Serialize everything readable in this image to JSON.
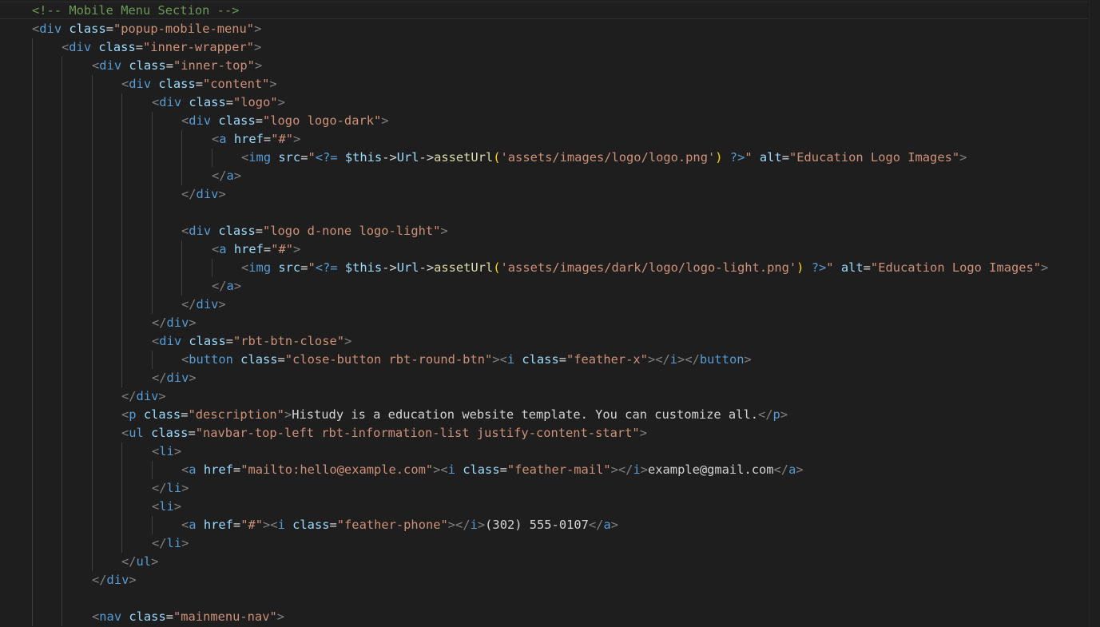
{
  "editor": {
    "theme": {
      "background": "#1e1e1e",
      "comment": "#6a9955",
      "tag": "#569cd6",
      "attribute": "#9cdcfe",
      "string": "#ce9178",
      "text": "#d4d4d4",
      "punctuation": "#808080",
      "function": "#dcdcaa",
      "bracket": "#ffd700"
    },
    "lines": [
      {
        "indent": 1,
        "tokens": [
          [
            "<!-- Mobile Menu Section -->",
            "comment"
          ]
        ]
      },
      {
        "indent": 1,
        "tokens": [
          [
            "<",
            "punct"
          ],
          [
            "div",
            "tag"
          ],
          [
            " ",
            "text"
          ],
          [
            "class",
            "attr"
          ],
          [
            "=",
            "eq"
          ],
          [
            "\"popup-mobile-menu\"",
            "str"
          ],
          [
            ">",
            "punct"
          ]
        ]
      },
      {
        "indent": 2,
        "tokens": [
          [
            "<",
            "punct"
          ],
          [
            "div",
            "tag"
          ],
          [
            " ",
            "text"
          ],
          [
            "class",
            "attr"
          ],
          [
            "=",
            "eq"
          ],
          [
            "\"inner-wrapper\"",
            "str"
          ],
          [
            ">",
            "punct"
          ]
        ]
      },
      {
        "indent": 3,
        "tokens": [
          [
            "<",
            "punct"
          ],
          [
            "div",
            "tag"
          ],
          [
            " ",
            "text"
          ],
          [
            "class",
            "attr"
          ],
          [
            "=",
            "eq"
          ],
          [
            "\"inner-top\"",
            "str"
          ],
          [
            ">",
            "punct"
          ]
        ]
      },
      {
        "indent": 4,
        "tokens": [
          [
            "<",
            "punct"
          ],
          [
            "div",
            "tag"
          ],
          [
            " ",
            "text"
          ],
          [
            "class",
            "attr"
          ],
          [
            "=",
            "eq"
          ],
          [
            "\"content\"",
            "str"
          ],
          [
            ">",
            "punct"
          ]
        ]
      },
      {
        "indent": 5,
        "tokens": [
          [
            "<",
            "punct"
          ],
          [
            "div",
            "tag"
          ],
          [
            " ",
            "text"
          ],
          [
            "class",
            "attr"
          ],
          [
            "=",
            "eq"
          ],
          [
            "\"logo\"",
            "str"
          ],
          [
            ">",
            "punct"
          ]
        ]
      },
      {
        "indent": 6,
        "tokens": [
          [
            "<",
            "punct"
          ],
          [
            "div",
            "tag"
          ],
          [
            " ",
            "text"
          ],
          [
            "class",
            "attr"
          ],
          [
            "=",
            "eq"
          ],
          [
            "\"logo logo-dark\"",
            "str"
          ],
          [
            ">",
            "punct"
          ]
        ]
      },
      {
        "indent": 7,
        "tokens": [
          [
            "<",
            "punct"
          ],
          [
            "a",
            "tag"
          ],
          [
            " ",
            "text"
          ],
          [
            "href",
            "attr"
          ],
          [
            "=",
            "eq"
          ],
          [
            "\"#\"",
            "str"
          ],
          [
            ">",
            "punct"
          ]
        ]
      },
      {
        "indent": 8,
        "tokens": [
          [
            "<",
            "punct"
          ],
          [
            "img",
            "tag"
          ],
          [
            " ",
            "text"
          ],
          [
            "src",
            "attr"
          ],
          [
            "=",
            "eq"
          ],
          [
            "\"",
            "str"
          ],
          [
            "<?=",
            "php"
          ],
          [
            " ",
            "text"
          ],
          [
            "$this",
            "var"
          ],
          [
            "->",
            "op"
          ],
          [
            "Url",
            "var"
          ],
          [
            "->",
            "op"
          ],
          [
            "assetUrl",
            "fn"
          ],
          [
            "(",
            "paren"
          ],
          [
            "'assets/images/logo/logo.png'",
            "str"
          ],
          [
            ")",
            "paren"
          ],
          [
            " ",
            "text"
          ],
          [
            "?>",
            "php"
          ],
          [
            "\"",
            "str"
          ],
          [
            " ",
            "text"
          ],
          [
            "alt",
            "attr"
          ],
          [
            "=",
            "eq"
          ],
          [
            "\"Education Logo Images\"",
            "str"
          ],
          [
            ">",
            "punct"
          ]
        ]
      },
      {
        "indent": 7,
        "tokens": [
          [
            "</",
            "punct"
          ],
          [
            "a",
            "tag"
          ],
          [
            ">",
            "punct"
          ]
        ]
      },
      {
        "indent": 6,
        "tokens": [
          [
            "</",
            "punct"
          ],
          [
            "div",
            "tag"
          ],
          [
            ">",
            "punct"
          ]
        ]
      },
      {
        "indent": 6,
        "tokens": []
      },
      {
        "indent": 6,
        "tokens": [
          [
            "<",
            "punct"
          ],
          [
            "div",
            "tag"
          ],
          [
            " ",
            "text"
          ],
          [
            "class",
            "attr"
          ],
          [
            "=",
            "eq"
          ],
          [
            "\"logo d-none logo-light\"",
            "str"
          ],
          [
            ">",
            "punct"
          ]
        ]
      },
      {
        "indent": 7,
        "tokens": [
          [
            "<",
            "punct"
          ],
          [
            "a",
            "tag"
          ],
          [
            " ",
            "text"
          ],
          [
            "href",
            "attr"
          ],
          [
            "=",
            "eq"
          ],
          [
            "\"#\"",
            "str"
          ],
          [
            ">",
            "punct"
          ]
        ]
      },
      {
        "indent": 8,
        "tokens": [
          [
            "<",
            "punct"
          ],
          [
            "img",
            "tag"
          ],
          [
            " ",
            "text"
          ],
          [
            "src",
            "attr"
          ],
          [
            "=",
            "eq"
          ],
          [
            "\"",
            "str"
          ],
          [
            "<?=",
            "php"
          ],
          [
            " ",
            "text"
          ],
          [
            "$this",
            "var"
          ],
          [
            "->",
            "op"
          ],
          [
            "Url",
            "var"
          ],
          [
            "->",
            "op"
          ],
          [
            "assetUrl",
            "fn"
          ],
          [
            "(",
            "paren"
          ],
          [
            "'assets/images/dark/logo/logo-light.png'",
            "str"
          ],
          [
            ")",
            "paren"
          ],
          [
            " ",
            "text"
          ],
          [
            "?>",
            "php"
          ],
          [
            "\"",
            "str"
          ],
          [
            " ",
            "text"
          ],
          [
            "alt",
            "attr"
          ],
          [
            "=",
            "eq"
          ],
          [
            "\"Education Logo Images\"",
            "str"
          ],
          [
            ">",
            "punct"
          ]
        ]
      },
      {
        "indent": 7,
        "tokens": [
          [
            "</",
            "punct"
          ],
          [
            "a",
            "tag"
          ],
          [
            ">",
            "punct"
          ]
        ]
      },
      {
        "indent": 6,
        "tokens": [
          [
            "</",
            "punct"
          ],
          [
            "div",
            "tag"
          ],
          [
            ">",
            "punct"
          ]
        ]
      },
      {
        "indent": 5,
        "tokens": [
          [
            "</",
            "punct"
          ],
          [
            "div",
            "tag"
          ],
          [
            ">",
            "punct"
          ]
        ]
      },
      {
        "indent": 5,
        "tokens": [
          [
            "<",
            "punct"
          ],
          [
            "div",
            "tag"
          ],
          [
            " ",
            "text"
          ],
          [
            "class",
            "attr"
          ],
          [
            "=",
            "eq"
          ],
          [
            "\"rbt-btn-close\"",
            "str"
          ],
          [
            ">",
            "punct"
          ]
        ]
      },
      {
        "indent": 6,
        "tokens": [
          [
            "<",
            "punct"
          ],
          [
            "button",
            "tag"
          ],
          [
            " ",
            "text"
          ],
          [
            "class",
            "attr"
          ],
          [
            "=",
            "eq"
          ],
          [
            "\"close-button rbt-round-btn\"",
            "str"
          ],
          [
            ">",
            "punct"
          ],
          [
            "<",
            "punct"
          ],
          [
            "i",
            "tag"
          ],
          [
            " ",
            "text"
          ],
          [
            "class",
            "attr"
          ],
          [
            "=",
            "eq"
          ],
          [
            "\"feather-x\"",
            "str"
          ],
          [
            ">",
            "punct"
          ],
          [
            "</",
            "punct"
          ],
          [
            "i",
            "tag"
          ],
          [
            ">",
            "punct"
          ],
          [
            "</",
            "punct"
          ],
          [
            "button",
            "tag"
          ],
          [
            ">",
            "punct"
          ]
        ]
      },
      {
        "indent": 5,
        "tokens": [
          [
            "</",
            "punct"
          ],
          [
            "div",
            "tag"
          ],
          [
            ">",
            "punct"
          ]
        ]
      },
      {
        "indent": 4,
        "tokens": [
          [
            "</",
            "punct"
          ],
          [
            "div",
            "tag"
          ],
          [
            ">",
            "punct"
          ]
        ]
      },
      {
        "indent": 4,
        "tokens": [
          [
            "<",
            "punct"
          ],
          [
            "p",
            "tag"
          ],
          [
            " ",
            "text"
          ],
          [
            "class",
            "attr"
          ],
          [
            "=",
            "eq"
          ],
          [
            "\"description\"",
            "str"
          ],
          [
            ">",
            "punct"
          ],
          [
            "Histudy is a education website template. You can customize all.",
            "text"
          ],
          [
            "</",
            "punct"
          ],
          [
            "p",
            "tag"
          ],
          [
            ">",
            "punct"
          ]
        ]
      },
      {
        "indent": 4,
        "tokens": [
          [
            "<",
            "punct"
          ],
          [
            "ul",
            "tag"
          ],
          [
            " ",
            "text"
          ],
          [
            "class",
            "attr"
          ],
          [
            "=",
            "eq"
          ],
          [
            "\"navbar-top-left rbt-information-list justify-content-start\"",
            "str"
          ],
          [
            ">",
            "punct"
          ]
        ]
      },
      {
        "indent": 5,
        "tokens": [
          [
            "<",
            "punct"
          ],
          [
            "li",
            "tag"
          ],
          [
            ">",
            "punct"
          ]
        ]
      },
      {
        "indent": 6,
        "tokens": [
          [
            "<",
            "punct"
          ],
          [
            "a",
            "tag"
          ],
          [
            " ",
            "text"
          ],
          [
            "href",
            "attr"
          ],
          [
            "=",
            "eq"
          ],
          [
            "\"mailto:hello@example.com\"",
            "str"
          ],
          [
            ">",
            "punct"
          ],
          [
            "<",
            "punct"
          ],
          [
            "i",
            "tag"
          ],
          [
            " ",
            "text"
          ],
          [
            "class",
            "attr"
          ],
          [
            "=",
            "eq"
          ],
          [
            "\"feather-mail\"",
            "str"
          ],
          [
            ">",
            "punct"
          ],
          [
            "</",
            "punct"
          ],
          [
            "i",
            "tag"
          ],
          [
            ">",
            "punct"
          ],
          [
            "example@gmail.com",
            "text"
          ],
          [
            "</",
            "punct"
          ],
          [
            "a",
            "tag"
          ],
          [
            ">",
            "punct"
          ]
        ]
      },
      {
        "indent": 5,
        "tokens": [
          [
            "</",
            "punct"
          ],
          [
            "li",
            "tag"
          ],
          [
            ">",
            "punct"
          ]
        ]
      },
      {
        "indent": 5,
        "tokens": [
          [
            "<",
            "punct"
          ],
          [
            "li",
            "tag"
          ],
          [
            ">",
            "punct"
          ]
        ]
      },
      {
        "indent": 6,
        "tokens": [
          [
            "<",
            "punct"
          ],
          [
            "a",
            "tag"
          ],
          [
            " ",
            "text"
          ],
          [
            "href",
            "attr"
          ],
          [
            "=",
            "eq"
          ],
          [
            "\"#\"",
            "str"
          ],
          [
            ">",
            "punct"
          ],
          [
            "<",
            "punct"
          ],
          [
            "i",
            "tag"
          ],
          [
            " ",
            "text"
          ],
          [
            "class",
            "attr"
          ],
          [
            "=",
            "eq"
          ],
          [
            "\"feather-phone\"",
            "str"
          ],
          [
            ">",
            "punct"
          ],
          [
            "</",
            "punct"
          ],
          [
            "i",
            "tag"
          ],
          [
            ">",
            "punct"
          ],
          [
            "(302) 555-0107",
            "text"
          ],
          [
            "</",
            "punct"
          ],
          [
            "a",
            "tag"
          ],
          [
            ">",
            "punct"
          ]
        ]
      },
      {
        "indent": 5,
        "tokens": [
          [
            "</",
            "punct"
          ],
          [
            "li",
            "tag"
          ],
          [
            ">",
            "punct"
          ]
        ]
      },
      {
        "indent": 4,
        "tokens": [
          [
            "</",
            "punct"
          ],
          [
            "ul",
            "tag"
          ],
          [
            ">",
            "punct"
          ]
        ]
      },
      {
        "indent": 3,
        "tokens": [
          [
            "</",
            "punct"
          ],
          [
            "div",
            "tag"
          ],
          [
            ">",
            "punct"
          ]
        ]
      },
      {
        "indent": 3,
        "tokens": []
      },
      {
        "indent": 3,
        "tokens": [
          [
            "<",
            "punct"
          ],
          [
            "nav",
            "tag"
          ],
          [
            " ",
            "text"
          ],
          [
            "class",
            "attr"
          ],
          [
            "=",
            "eq"
          ],
          [
            "\"mainmenu-nav\"",
            "str"
          ],
          [
            ">",
            "punct"
          ]
        ]
      }
    ]
  }
}
